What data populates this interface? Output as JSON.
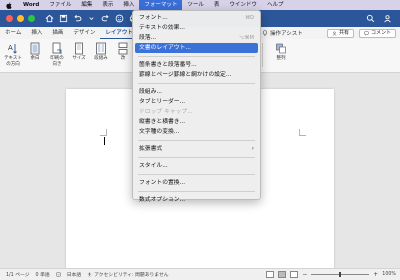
{
  "menubar": {
    "app": "Word",
    "items": [
      "ファイル",
      "編集",
      "表示",
      "挿入",
      "フォーマット",
      "ツール",
      "表",
      "ウインドウ",
      "ヘルプ"
    ],
    "active_index": 4
  },
  "ribbon_tabs": {
    "items": [
      "ホーム",
      "挿入",
      "描画",
      "デザイン",
      "レイアウト"
    ],
    "active_index": 4,
    "tell_me": "操作アシスト",
    "share": "共有",
    "comments": "コメント"
  },
  "ribbon": {
    "buttons": [
      {
        "label": "テキスト\nの方向",
        "icon": "text-direction-icon"
      },
      {
        "label": "余白",
        "icon": "margins-icon"
      },
      {
        "label": "印刷の\n向き",
        "icon": "orientation-icon"
      },
      {
        "label": "サイズ",
        "icon": "size-icon"
      },
      {
        "label": "段組み",
        "icon": "columns-icon"
      },
      {
        "label": "改",
        "icon": "breaks-icon"
      },
      {
        "label": "整列",
        "icon": "arrange-icon"
      }
    ]
  },
  "format_menu": {
    "items": [
      {
        "label": "フォント...",
        "shortcut": "⌘D",
        "disabled": false
      },
      {
        "label": "テキストの効果...",
        "shortcut": "",
        "disabled": false
      },
      {
        "label": "段落...",
        "shortcut": "⌥⌘M",
        "disabled": false
      },
      {
        "label": "文書のレイアウト...",
        "shortcut": "",
        "disabled": false,
        "highlighted": true
      },
      {
        "sep": true
      },
      {
        "label": "箇条書きと段落番号...",
        "shortcut": "",
        "disabled": false
      },
      {
        "label": "罫線とページ罫線と網かけの設定...",
        "shortcut": "",
        "disabled": false
      },
      {
        "sep": true
      },
      {
        "label": "段組み...",
        "shortcut": "",
        "disabled": false
      },
      {
        "label": "タブとリーダー...",
        "shortcut": "",
        "disabled": false
      },
      {
        "label": "ドロップ キャップ...",
        "shortcut": "",
        "disabled": true
      },
      {
        "label": "縦書きと横書き...",
        "shortcut": "",
        "disabled": false
      },
      {
        "label": "文字種の変換...",
        "shortcut": "",
        "disabled": false
      },
      {
        "sep": true
      },
      {
        "label": "拡張書式",
        "shortcut": "",
        "disabled": false,
        "submenu": true
      },
      {
        "sep": true
      },
      {
        "label": "スタイル...",
        "shortcut": "",
        "disabled": false
      },
      {
        "sep": true
      },
      {
        "label": "フォントの置換...",
        "shortcut": "",
        "disabled": false
      },
      {
        "sep": true
      },
      {
        "label": "数式オプション...",
        "shortcut": "",
        "disabled": false
      }
    ]
  },
  "statusbar": {
    "page": "1/1 ページ",
    "words": "0 単語",
    "language": "日本語",
    "accessibility": "アクセシビリティ: 問題ありません",
    "zoom": "100%",
    "zoom_level": 0.5
  },
  "colors": {
    "accent": "#2b579a",
    "menu_highlight": "#3b72d9",
    "menubar_bg": "#d8d2e8"
  }
}
